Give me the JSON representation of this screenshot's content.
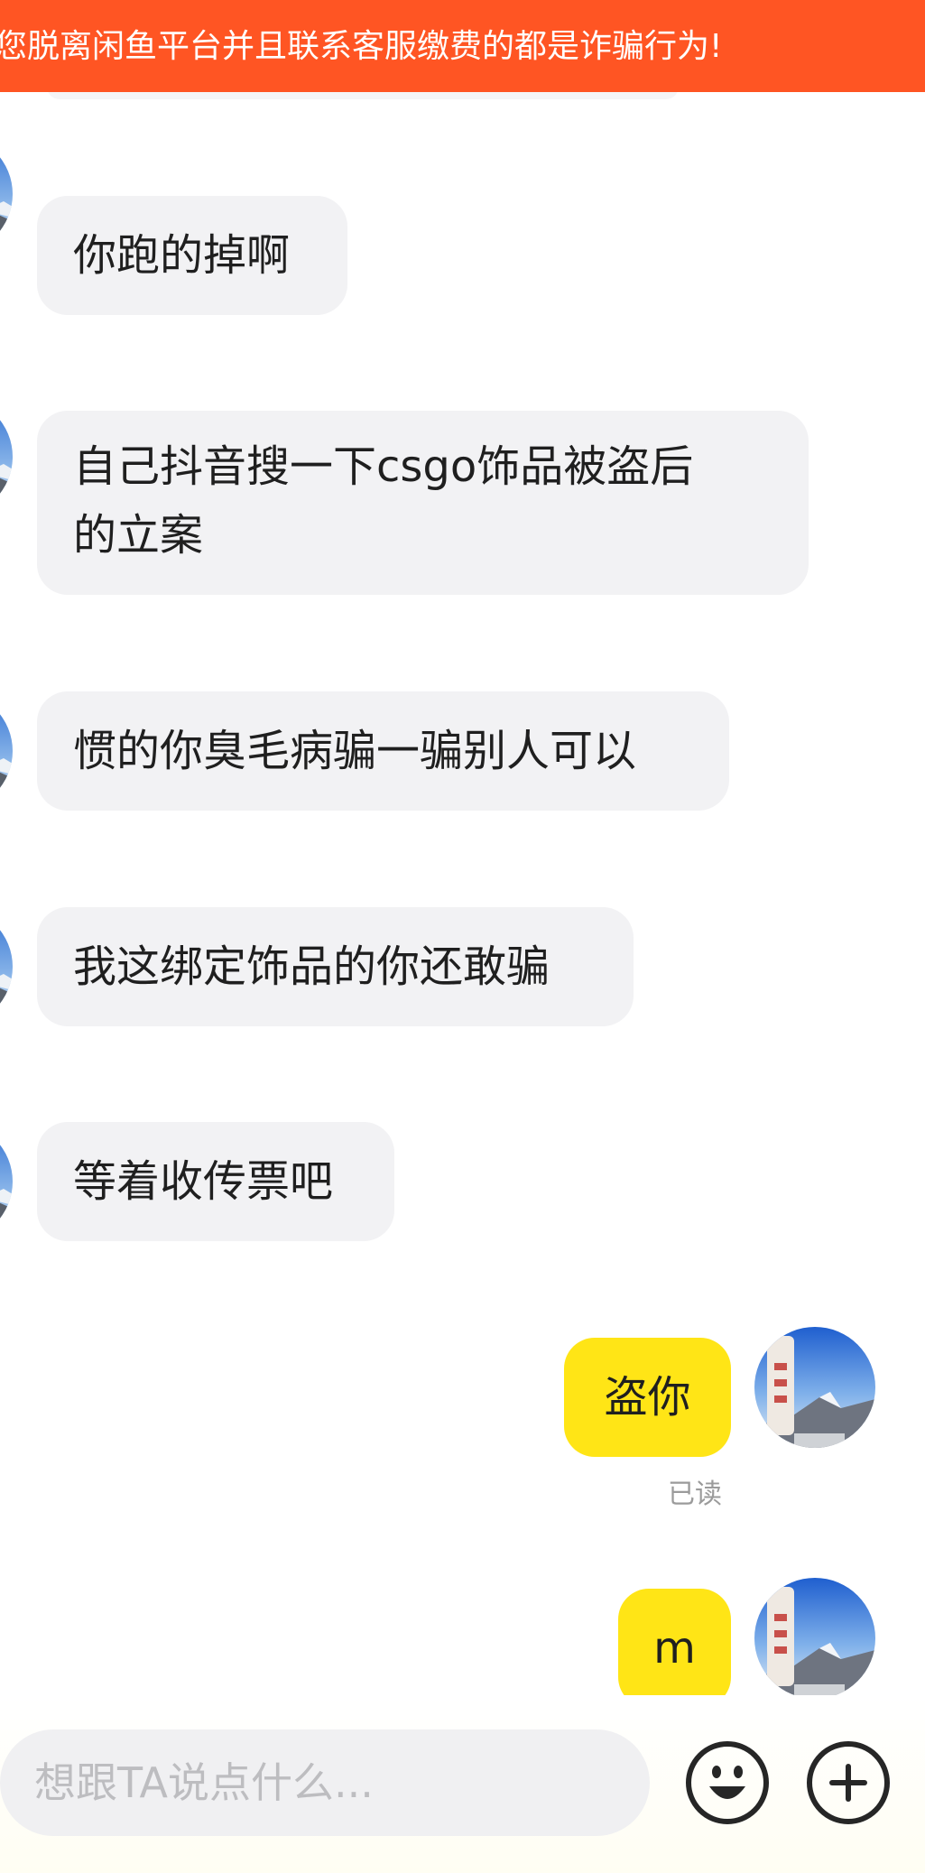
{
  "banner": {
    "text": "您脱离闲鱼平台并且联系客服缴费的都是诈骗行为!"
  },
  "messages": [
    {
      "side": "in",
      "text": "你跑的掉啊"
    },
    {
      "side": "in",
      "line1": "自己抖音搜一下csgo饰品被盗后",
      "line2": "的立案"
    },
    {
      "side": "in",
      "text": "惯的你臭毛病骗一骗别人可以"
    },
    {
      "side": "in",
      "text": "我这绑定饰品的你还敢骗"
    },
    {
      "side": "in",
      "text": "等着收传票吧"
    },
    {
      "side": "out",
      "text": "盗你",
      "status": "已读"
    },
    {
      "side": "out",
      "text": "m"
    }
  ],
  "composer": {
    "placeholder": "想跟TA说点什么...",
    "emoji_icon": "emoji-icon",
    "plus_icon": "plus-icon"
  },
  "colors": {
    "banner_bg": "#ff5523",
    "incoming_bubble": "#f2f2f4",
    "outgoing_bubble": "#ffe516",
    "read_status": "#9b9b9b"
  }
}
